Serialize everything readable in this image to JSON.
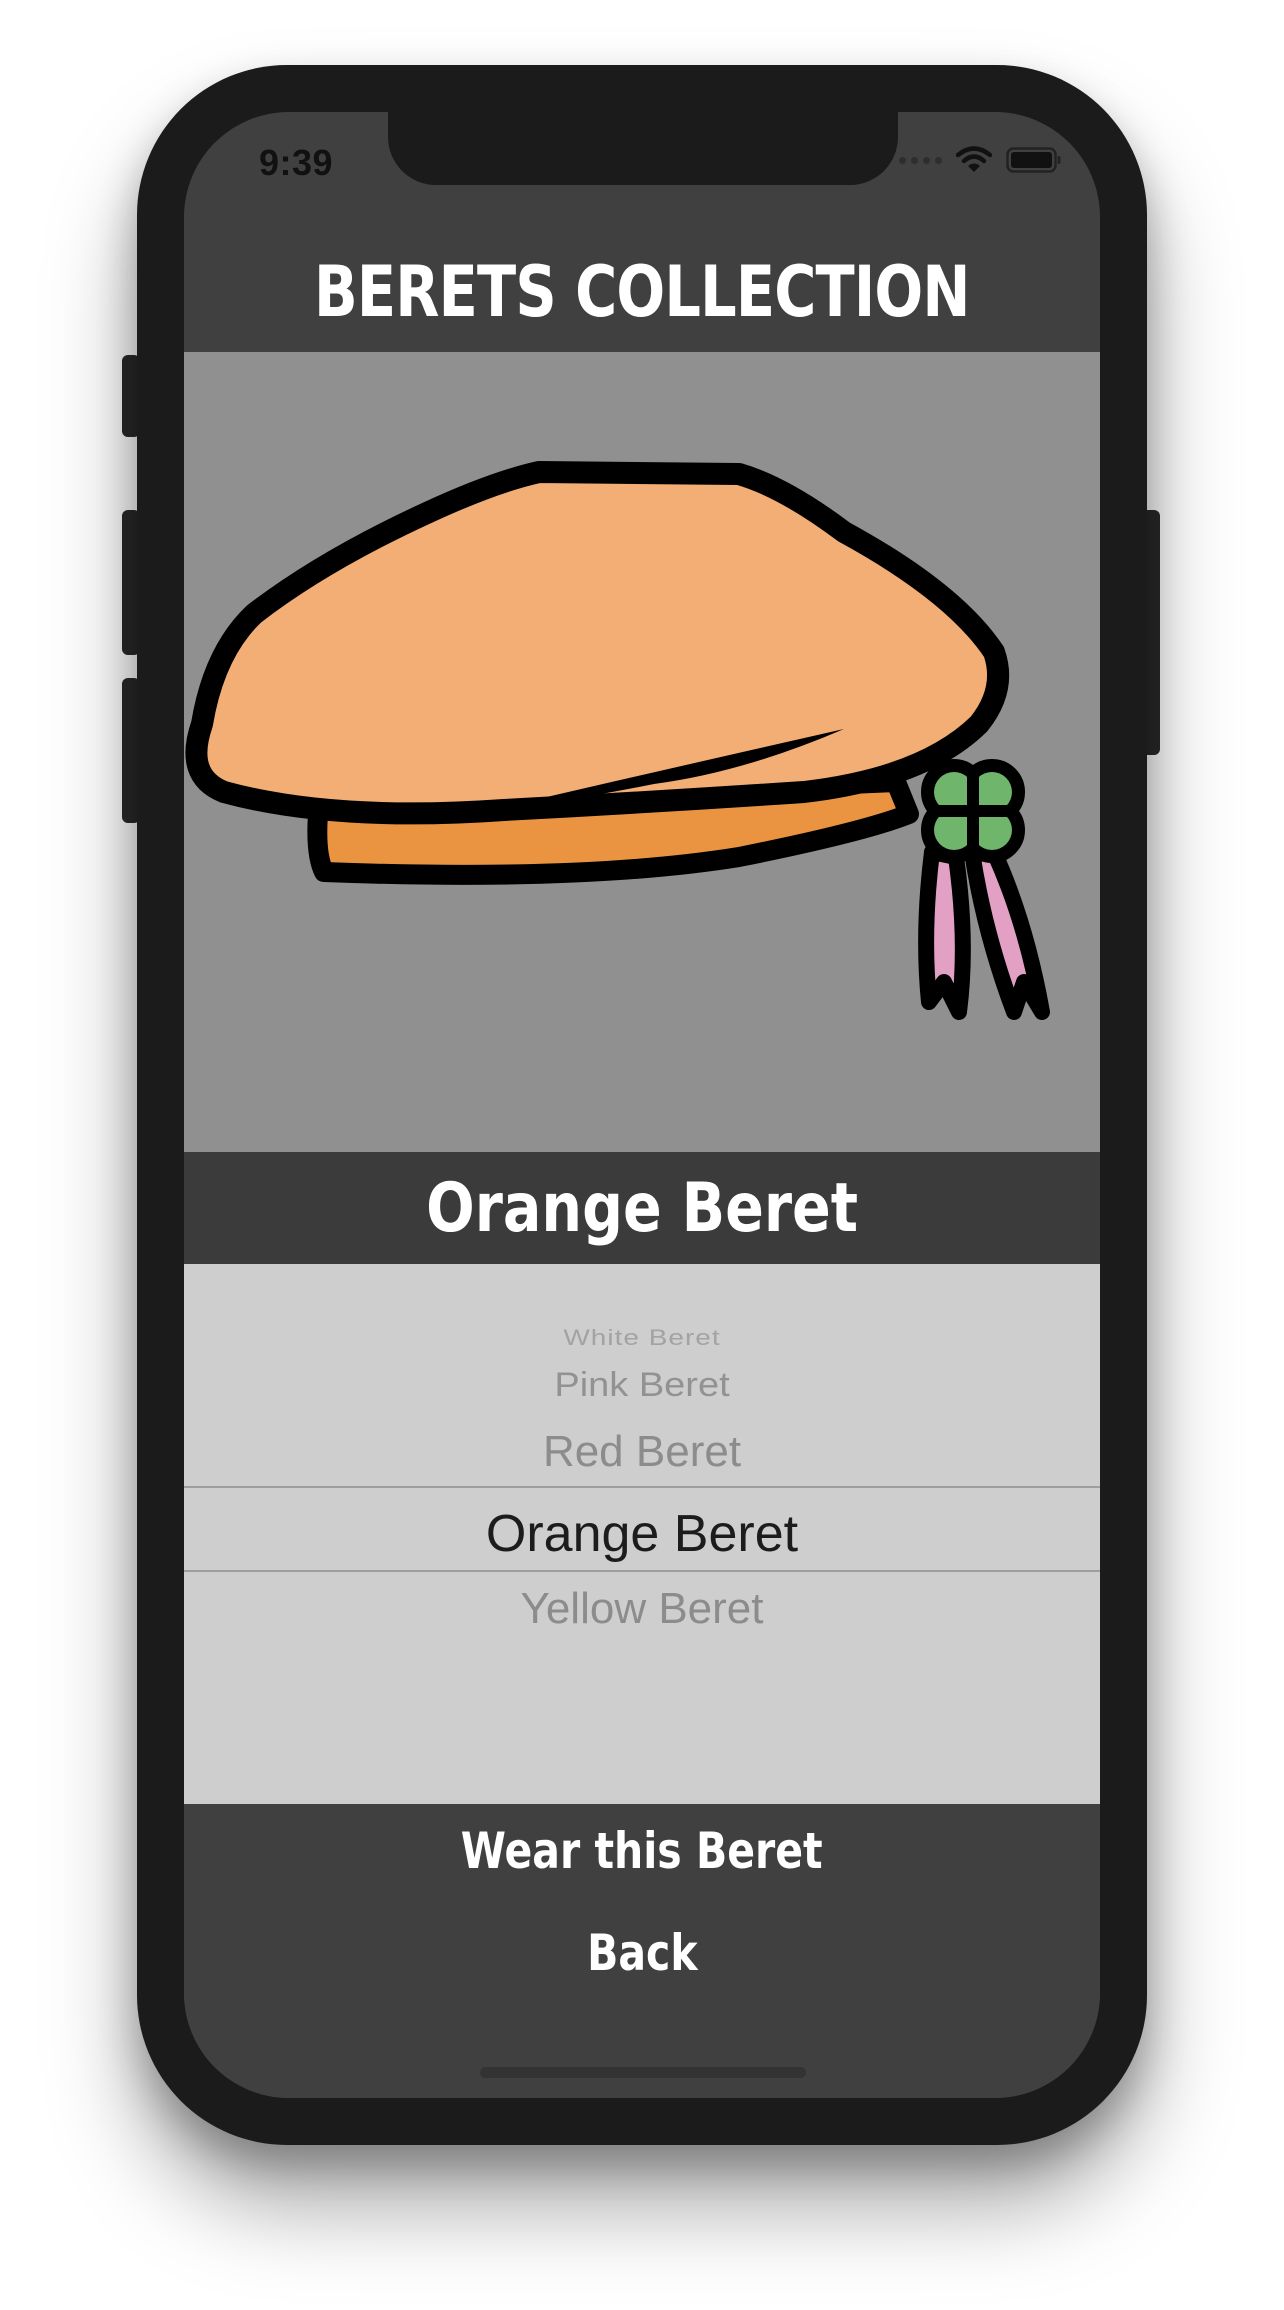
{
  "status_bar": {
    "time": "9:39",
    "icons": [
      "signal-dots-icon",
      "wifi-icon",
      "battery-icon"
    ]
  },
  "header": {
    "title": "BERETS COLLECTION"
  },
  "preview": {
    "image": "orange-beret-illustration",
    "colors": {
      "beret_top": "#F2AE74",
      "beret_band": "#EA9442",
      "clover": "#6FB56C",
      "ribbon": "#E2A0C4",
      "background": "#909090"
    }
  },
  "selected_name": "Orange Beret",
  "picker": {
    "items": [
      "White Beret",
      "Pink Beret",
      "Red Beret",
      "Orange Beret",
      "Yellow Beret"
    ],
    "selected": "Orange Beret"
  },
  "actions": {
    "wear_label": "Wear this Beret",
    "back_label": "Back"
  }
}
